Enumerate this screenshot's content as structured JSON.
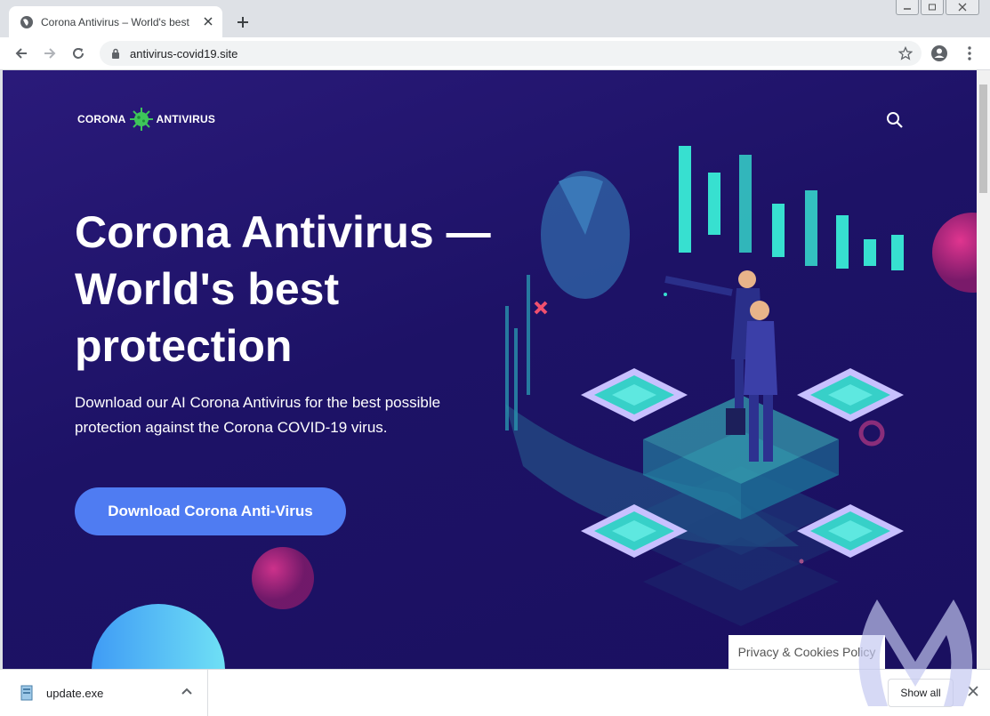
{
  "browser": {
    "tab_title": "Corona Antivirus – World's best F",
    "url": "antivirus-covid19.site"
  },
  "site": {
    "logo_left": "CORONA",
    "logo_right": "ANTIVIRUS",
    "hero_title": "Corona Antivirus — World's best protection",
    "hero_subtitle": "Download our AI Corona Antivirus for the best possible protection against the Corona COVID-19 virus.",
    "cta_label": "Download Corona Anti-Virus",
    "privacy_label": "Privacy & Cookies Policy"
  },
  "downloads": {
    "file_name": "update.exe",
    "show_all_label": "Show all"
  },
  "colors": {
    "page_bg": "#1d1266",
    "cta_bg": "#4f7cf2",
    "accent_teal": "#37e0d0",
    "accent_pink": "#d7348f"
  },
  "icons": [
    "globe-icon",
    "close-icon",
    "plus-icon",
    "back-arrow-icon",
    "forward-arrow-icon",
    "reload-icon",
    "lock-icon",
    "star-icon",
    "account-icon",
    "menu-dots-icon",
    "search-icon",
    "virus-icon",
    "file-icon",
    "chevron-up-icon"
  ]
}
